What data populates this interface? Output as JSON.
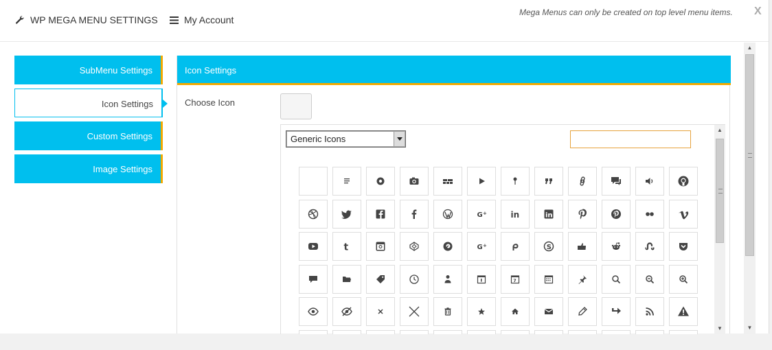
{
  "topbar": {
    "settings_title": "WP MEGA MENU SETTINGS",
    "account_label": "My Account",
    "notice": "Mega Menus can only be created on top level menu items.",
    "close_label": "X"
  },
  "tabs": [
    {
      "label": "SubMenu Settings",
      "active": false
    },
    {
      "label": "Icon Settings",
      "active": true
    },
    {
      "label": "Custom Settings",
      "active": false
    },
    {
      "label": "Image Settings",
      "active": false
    }
  ],
  "panel": {
    "title": "Icon Settings",
    "choose_icon_label": "Choose Icon",
    "icon_set_selected": "Generic Icons",
    "search_value": ""
  },
  "colors": {
    "accent": "#00bfee",
    "tab_border": "#f2a900",
    "icon": "#444444"
  },
  "icons": [
    [
      "blank-icon",
      "standard-icon",
      "aside-icon",
      "image-icon",
      "gallery-icon",
      "video-icon",
      "status-icon",
      "quote-icon",
      "link-icon",
      "chat-icon",
      "audio-icon",
      "github-icon"
    ],
    [
      "dribbble-icon",
      "twitter-icon",
      "facebook-square-icon",
      "facebook-icon",
      "wordpress-icon",
      "googleplus-icon",
      "linkedin-icon",
      "linkedin-square-icon",
      "pinterest-icon",
      "pinterest-circle-icon",
      "flickr-icon",
      "vimeo-icon"
    ],
    [
      "youtube-icon",
      "tumblr-icon",
      "instagram-icon",
      "codepen-icon",
      "polldaddy-icon",
      "googleplus-alt-icon",
      "path-icon",
      "skype-icon",
      "digg-icon",
      "reddit-icon",
      "stumbleupon-icon",
      "pocket-icon"
    ],
    [
      "comment-icon",
      "category-icon",
      "tag-icon",
      "time-icon",
      "user-icon",
      "day-icon",
      "week-icon",
      "month-icon",
      "pinned-icon",
      "search-icon",
      "unzoom-icon",
      "zoom-icon"
    ],
    [
      "show-icon",
      "hide-icon",
      "close-icon",
      "close-alt-icon",
      "trash-icon",
      "star-icon",
      "home-icon",
      "mail-icon",
      "edit-icon",
      "reply-icon",
      "feed-icon",
      "warning-icon"
    ],
    [
      "share-icon",
      "attachment-icon",
      "location-icon",
      "checkmark-icon",
      "menu-icon",
      "refresh-icon",
      "minimize-icon",
      "maximize-icon",
      "404-icon",
      "spam-icon",
      "summary-icon",
      "cloud-icon"
    ]
  ]
}
